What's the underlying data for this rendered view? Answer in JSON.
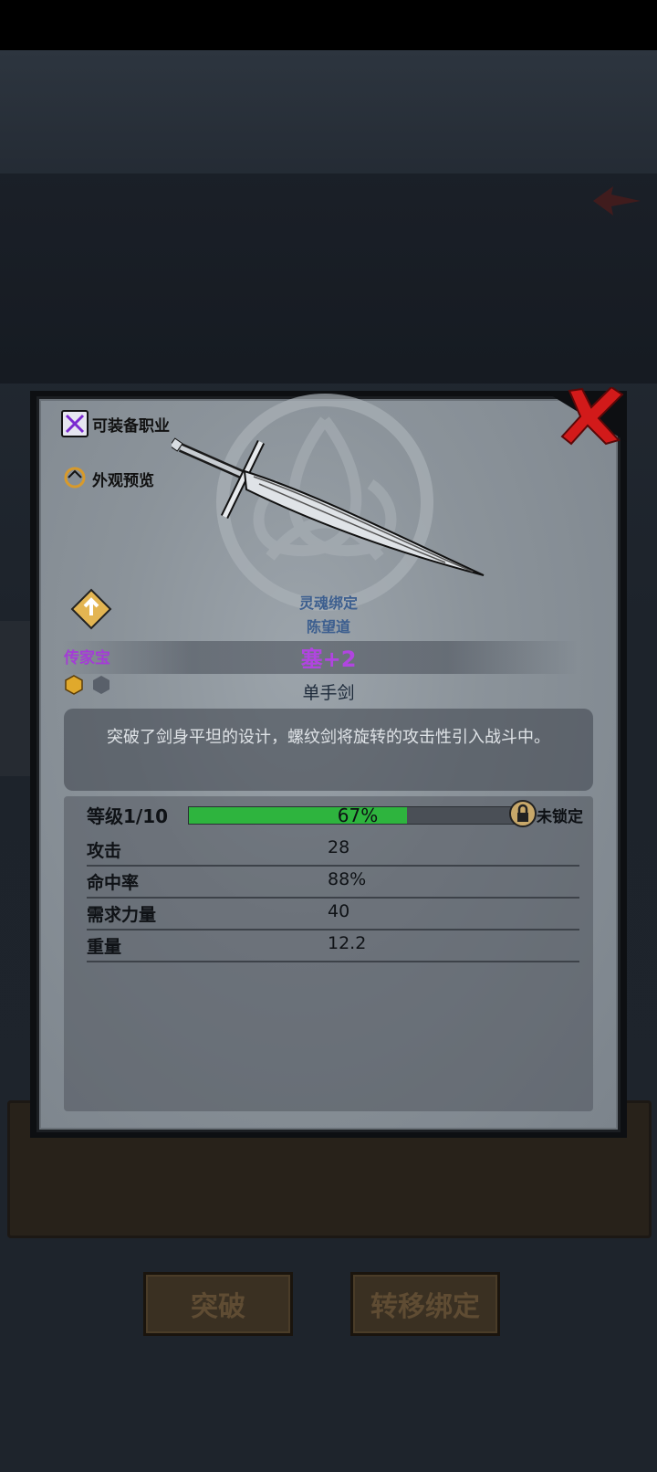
{
  "item": {
    "soulbind_label": "灵魂绑定",
    "soulbind_owner": "陈望道",
    "rarity": "传家宝",
    "name": "塞+2",
    "subtype": "单手剑",
    "description": "突破了剑身平坦的设计，螺纹剑将旋转的攻击性引入战斗中。"
  },
  "actions": {
    "equippable_classes": "可装备职业",
    "appearance_preview": "外观预览"
  },
  "level": {
    "label": "等级1/10",
    "progress_text": "67%",
    "progress": 0.67,
    "lock_status": "未锁定"
  },
  "stats": [
    {
      "name": "攻击",
      "value": "28"
    },
    {
      "name": "命中率",
      "value": "88%"
    },
    {
      "name": "需求力量",
      "value": "40"
    },
    {
      "name": "重量",
      "value": "12.2"
    }
  ],
  "background_buttons": {
    "breakthrough": "突破",
    "transfer_bind": "转移绑定"
  },
  "colors": {
    "rarity": "#a43cd6",
    "progress": "#2eb43e",
    "close": "#d21a1a"
  }
}
